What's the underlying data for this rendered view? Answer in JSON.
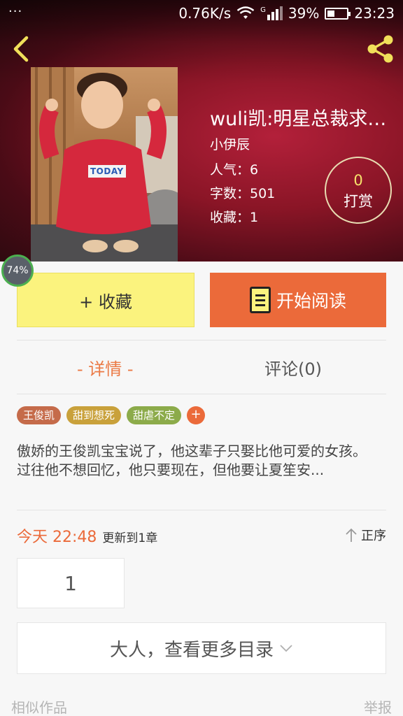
{
  "status_bar": {
    "dots": "···",
    "net_speed": "0.76K/s",
    "signal_tag": "G",
    "battery": "39%",
    "battery_level": 0.39,
    "time": "23:23"
  },
  "nav": {
    "back_icon": "chevron-left-icon",
    "share_icon": "share-icon"
  },
  "book": {
    "title": "wuli凯:明星总裁求抱...",
    "author": "小伊辰",
    "popularity": "人气：6",
    "word_count": "字数：501",
    "favorites": "收藏：1",
    "cover_text": "TODAY"
  },
  "tip": {
    "count": "0",
    "label": "打赏"
  },
  "reading_progress": "74%",
  "actions": {
    "favorite": "+ 收藏",
    "read": "开始阅读"
  },
  "tabs": {
    "detail": "- 详情 -",
    "comments": "评论(0)"
  },
  "tags": [
    {
      "label": "王俊凯",
      "color": "#c56b4a"
    },
    {
      "label": "甜到想死",
      "color": "#c9a13b"
    },
    {
      "label": "甜虐不定",
      "color": "#8cab4a"
    }
  ],
  "tag_add": "+",
  "description": {
    "line1": "傲娇的王俊凯宝宝说了，他这辈子只娶比他可爱的女孩。",
    "line2": "过往他不想回忆，他只要现在，但他要让夏笙安..."
  },
  "update": {
    "time": "今天 22:48",
    "text": "更新到1章"
  },
  "sort": {
    "label": "正序",
    "icon": "arrow-up-icon"
  },
  "pagination": {
    "current": "1"
  },
  "more_catalog": "大人，查看更多目录",
  "footer": {
    "similar": "相似作品",
    "report": "举报"
  },
  "colors": {
    "accent": "#eb6a3a",
    "fav_bg": "#fbf37e",
    "header_red": "#b3203a"
  }
}
